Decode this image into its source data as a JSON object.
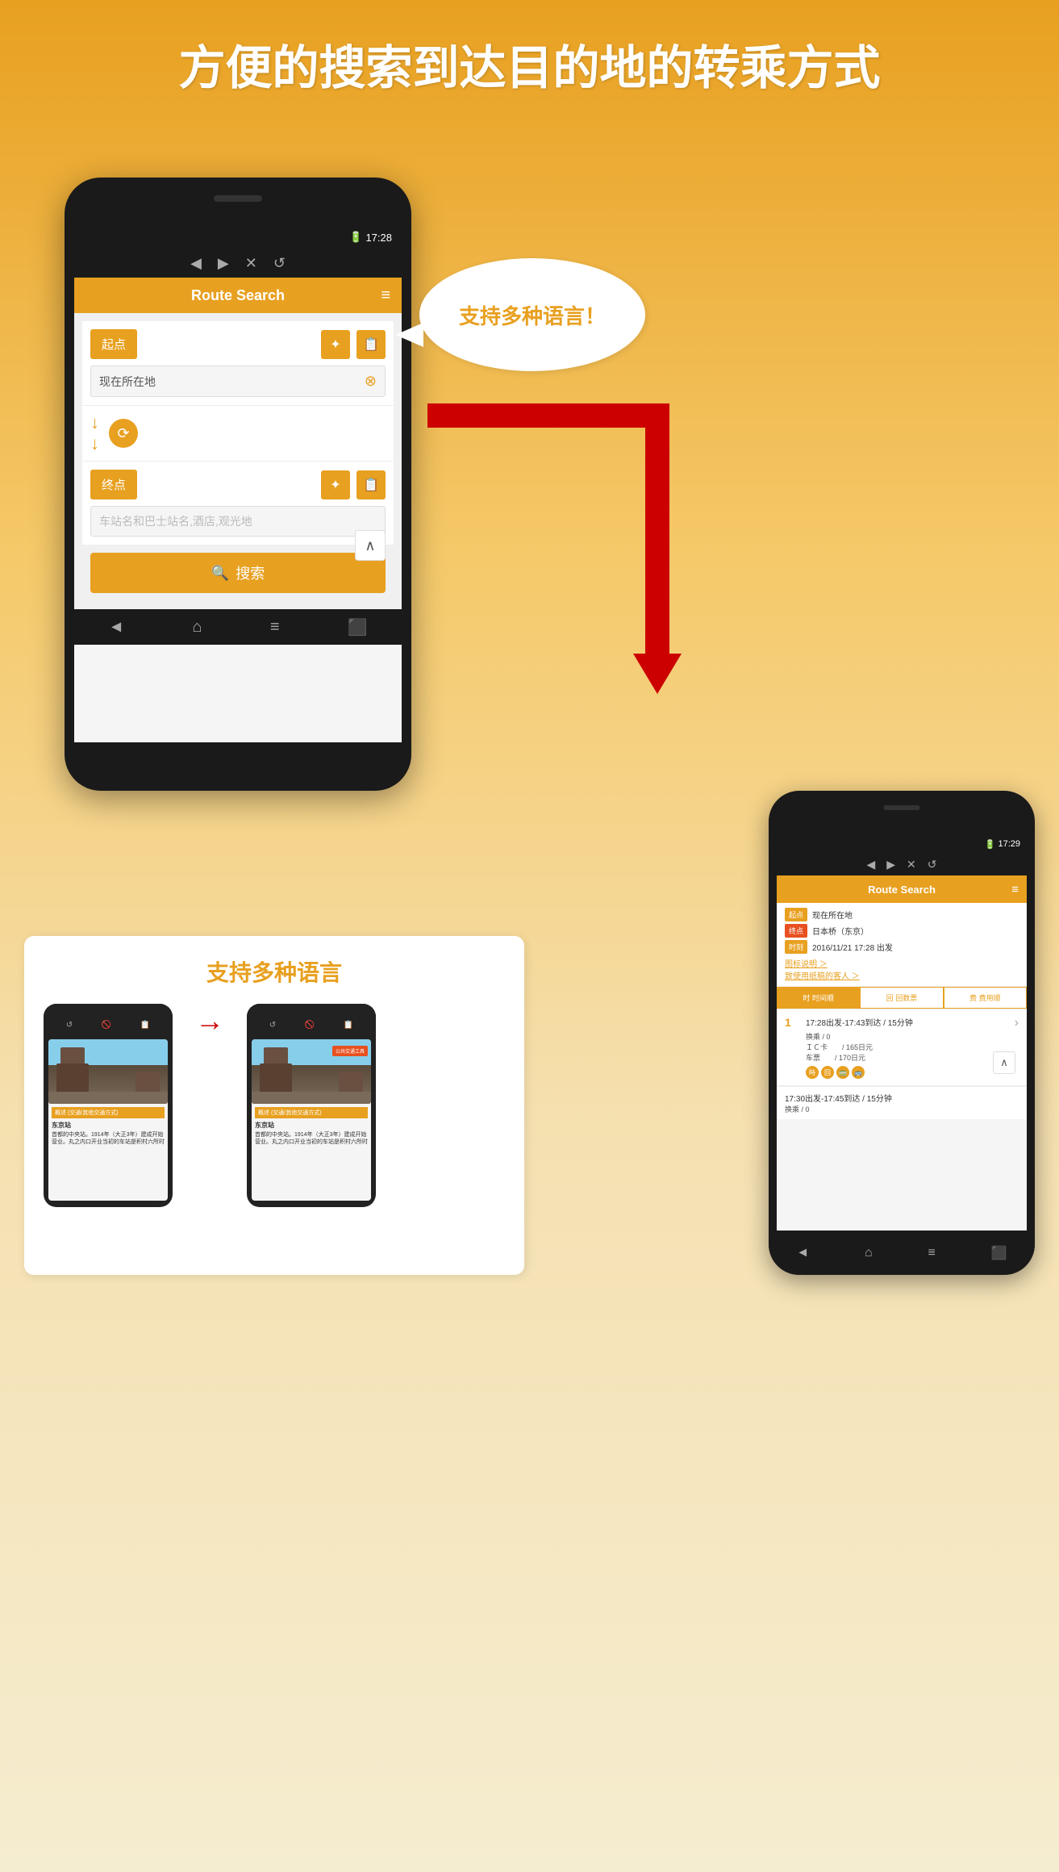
{
  "page": {
    "background_gradient_start": "#E8A020",
    "background_gradient_end": "#F5EDD0"
  },
  "header": {
    "title": "方便的搜索到达目的地的转乘方式"
  },
  "speech_bubble": {
    "text": "支持多种语言！"
  },
  "phone_large": {
    "status_time": "17:28",
    "app_title": "Route Search",
    "origin_label": "起点",
    "origin_value": "现在所在地",
    "dest_label": "终点",
    "dest_placeholder": "车站名和巴士站名,酒店,观光地",
    "search_btn_label": "搜索",
    "nav_back": "◀",
    "nav_forward": "▶",
    "nav_close": "✕",
    "nav_refresh": "↺"
  },
  "phone_small": {
    "status_time": "17:29",
    "app_title": "Route Search",
    "origin_label": "起点",
    "origin_value": "现在所在地",
    "dest_label": "终点",
    "dest_value": "日本桥（东京）",
    "time_label": "时刻",
    "time_value": "2016/11/21 17:28  出发",
    "icon_legend": "图标说明 ＞",
    "beginner_link": "致使用纸稿的客人 ＞",
    "tab_time": "时 时间顺",
    "tab_count": "回 回数票",
    "tab_cost": "费 费用顺",
    "result1_title": "17:28出发-17:43到达 / 15分钟",
    "result1_transfer": "换乘 / 0",
    "result1_ic": "ＩＣ卡　　/ 165日元",
    "result1_ticket": "车票　　/ 170日元",
    "result2_title": "17:30出发-17:45到达 / 15分钟",
    "result2_transfer": "换乘 / 0"
  },
  "info_box": {
    "title": "支持多种语言",
    "mini_phone1": {
      "text_label": "概述 (交通/其他交通方式)",
      "station_name": "东京站",
      "station_desc": "首都的中央站。1914年（大正3年）建成开始营业。丸之内口开业当初的车站是积村六所时"
    },
    "mini_phone2": {
      "text_label": "概述 (交通/其他交通方式)",
      "station_name": "东京站",
      "tooltip": "公共交通工具",
      "station_desc": "首都的中央站。1914年（大正3年）建成开始营业。丸之内口开业当初的车站是积村六所时"
    }
  },
  "icons": {
    "menu": "≡",
    "search": "🔍",
    "back": "◄",
    "forward": "►",
    "close": "✕",
    "refresh": "↺",
    "up_arrow": "∧",
    "down_arrows": "↓↓",
    "swap": "⟳",
    "location": "📍",
    "bookmark": "📋",
    "clear": "⊗",
    "home": "⌂",
    "list": "≡",
    "print": "🖨"
  }
}
